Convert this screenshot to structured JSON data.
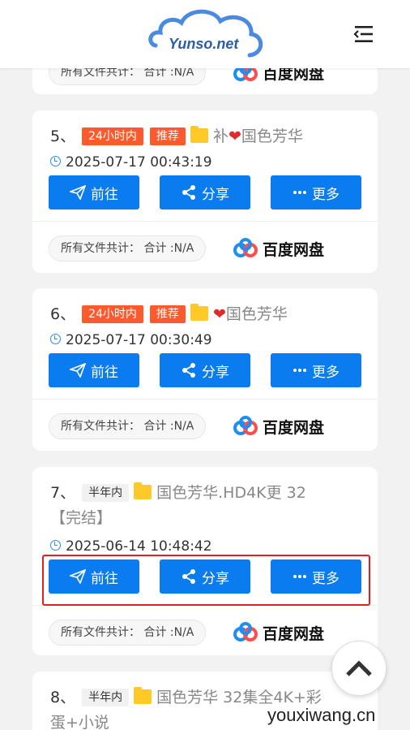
{
  "header": {
    "logo_text": "Yunso.net",
    "menu_icon": "menu-collapse-icon"
  },
  "common": {
    "total_label": "所有文件共计： 合计 :N/A",
    "provider": "百度网盘",
    "btn_go": "前往",
    "btn_share": "分享",
    "btn_more": "更多"
  },
  "cards": [
    {
      "num": "5、",
      "tags": [
        "24小时内",
        "推荐"
      ],
      "title_prefix": "补",
      "title": "国色芳华",
      "time": "2025-07-17 00:43:19"
    },
    {
      "num": "6、",
      "tags": [
        "24小时内",
        "推荐"
      ],
      "title_prefix": "",
      "title": "国色芳华",
      "time": "2025-07-17 00:30:49"
    },
    {
      "num": "7、",
      "tags": [
        "半年内"
      ],
      "title_line1": "国色芳华.HD4K更 32",
      "title_line2": "【完结】",
      "time": "2025-06-14 10:48:42"
    },
    {
      "num": "8、",
      "tags": [
        "半年内"
      ],
      "title_line1": "国色芳华 32集全4K+彩",
      "title_line2": "蛋+小说"
    }
  ],
  "watermark": "youxiwang.cn",
  "colors": {
    "primary": "#0a7cf0",
    "tag_red": "#ff5a2e",
    "highlight": "#e02020"
  }
}
